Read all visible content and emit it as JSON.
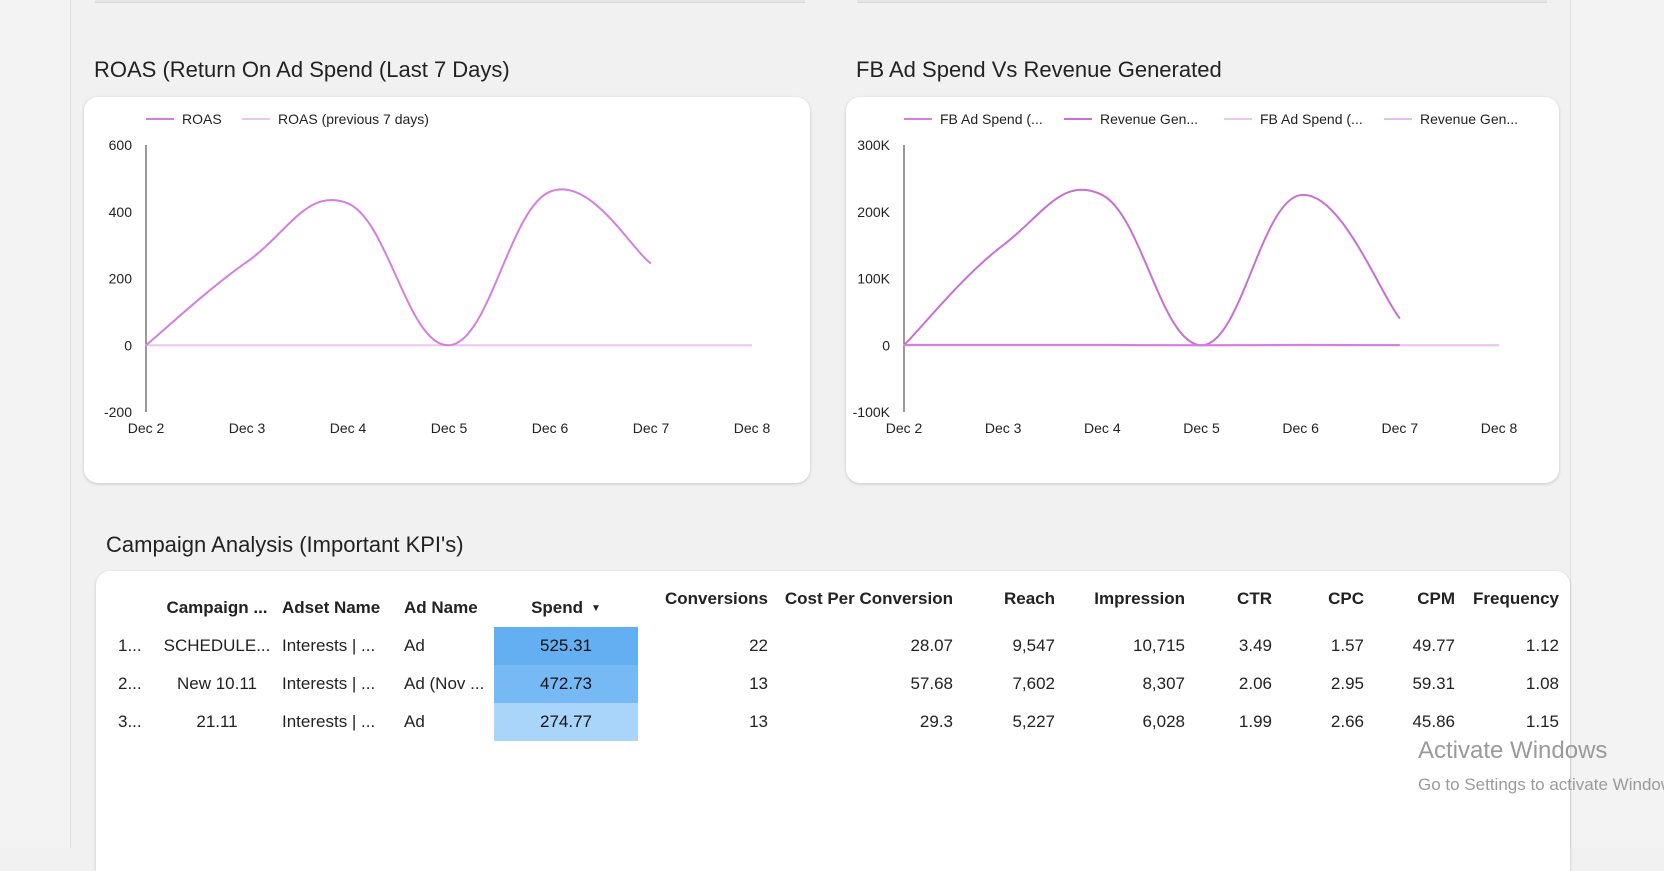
{
  "roas_chart": {
    "title": "ROAS (Return On Ad Spend (Last 7 Days)",
    "legend": [
      {
        "name": "ROAS",
        "color": "#d57ee0"
      },
      {
        "name": "ROAS (previous 7 days)",
        "color": "#ecc6f0"
      }
    ],
    "y_tick_labels": [
      "600",
      "400",
      "200",
      "0",
      "-200"
    ],
    "x_tick_labels": [
      "Dec 2",
      "Dec 3",
      "Dec 4",
      "Dec 5",
      "Dec 6",
      "Dec 7",
      "Dec 8"
    ]
  },
  "fb_chart": {
    "title": "FB Ad Spend Vs Revenue Generated",
    "legend": [
      {
        "name": "FB Ad Spend (...",
        "color": "#d57ee0"
      },
      {
        "name": "Revenue Gen...",
        "color": "#c86fd4"
      },
      {
        "name": "FB Ad Spend (...",
        "color": "#ecc6f0"
      },
      {
        "name": "Revenue Gen...",
        "color": "#e6bdea"
      }
    ],
    "y_tick_labels": [
      "300K",
      "200K",
      "100K",
      "0",
      "-100K"
    ],
    "x_tick_labels": [
      "Dec 2",
      "Dec 3",
      "Dec 4",
      "Dec 5",
      "Dec 6",
      "Dec 7",
      "Dec 8"
    ]
  },
  "chart_data": [
    {
      "type": "line",
      "title": "ROAS (Return On Ad Spend (Last 7 Days)",
      "x": [
        "Dec 2",
        "Dec 3",
        "Dec 4",
        "Dec 5",
        "Dec 6",
        "Dec 7",
        "Dec 8"
      ],
      "ylim": [
        -200,
        600
      ],
      "series": [
        {
          "name": "ROAS",
          "values": [
            0,
            250,
            425,
            0,
            460,
            245,
            null
          ],
          "color": "#d57ee0"
        },
        {
          "name": "ROAS (previous 7 days)",
          "values": [
            0,
            0,
            0,
            0,
            0,
            0,
            0
          ],
          "color": "#ecc6f0"
        }
      ],
      "legend_position": "top-left",
      "grid": false
    },
    {
      "type": "line",
      "title": "FB Ad Spend Vs Revenue Generated",
      "x": [
        "Dec 2",
        "Dec 3",
        "Dec 4",
        "Dec 5",
        "Dec 6",
        "Dec 7",
        "Dec 8"
      ],
      "ylim": [
        -100000,
        300000
      ],
      "series": [
        {
          "name": "FB Ad Spend (...",
          "values": [
            525,
            471,
            472,
            0,
            525,
            275,
            null
          ],
          "color": "#d57ee0"
        },
        {
          "name": "Revenue Gen...",
          "values": [
            0,
            150000,
            225000,
            0,
            225000,
            40000,
            null
          ],
          "color": "#c86fd4"
        },
        {
          "name": "FB Ad Spend (...",
          "values": [
            0,
            0,
            0,
            0,
            0,
            0,
            0
          ],
          "color": "#ecc6f0"
        },
        {
          "name": "Revenue Gen...",
          "values": [
            0,
            0,
            0,
            0,
            0,
            0,
            0
          ],
          "color": "#e6bdea"
        }
      ],
      "legend_position": "top-left",
      "grid": false
    },
    {
      "type": "table",
      "title": "Campaign Analysis (Important KPI's)",
      "columns": [
        "Campaign ...",
        "Adset Name",
        "Ad Name",
        "Spend",
        "Conversions",
        "Cost Per Conversion",
        "Reach",
        "Impression",
        "CTR",
        "CPC",
        "CPM",
        "Frequency"
      ],
      "sort_column": "Spend",
      "rows": [
        {
          "idx": "1...",
          "campaign": "SCHEDULE...",
          "adset": "Interests | ...",
          "ad": "Ad",
          "spend": "525.31",
          "spend_value": 525.31,
          "spend_color": "#64aff2",
          "conversions": "22",
          "cpconv": "28.07",
          "reach": "9,547",
          "impression": "10,715",
          "ctr": "3.49",
          "cpc": "1.57",
          "cpm": "49.77",
          "frequency": "1.12"
        },
        {
          "idx": "2...",
          "campaign": "New 10.11",
          "adset": "Interests | ...",
          "ad": "Ad (Nov ...",
          "spend": "472.73",
          "spend_value": 472.73,
          "spend_color": "#76b9f4",
          "conversions": "13",
          "cpconv": "57.68",
          "reach": "7,602",
          "impression": "8,307",
          "ctr": "2.06",
          "cpc": "2.95",
          "cpm": "59.31",
          "frequency": "1.08"
        },
        {
          "idx": "3...",
          "campaign": "21.11",
          "adset": "Interests | ...",
          "ad": "Ad",
          "spend": "274.77",
          "spend_value": 274.77,
          "spend_color": "#a9d5fa",
          "conversions": "13",
          "cpconv": "29.3",
          "reach": "5,227",
          "impression": "6,028",
          "ctr": "1.99",
          "cpc": "2.66",
          "cpm": "45.86",
          "frequency": "1.15"
        }
      ]
    }
  ],
  "watermark": {
    "line1": "Activate Windows",
    "line2": "Go to Settings to activate Windows."
  },
  "icons": {
    "sort": "sort-desc-icon"
  }
}
